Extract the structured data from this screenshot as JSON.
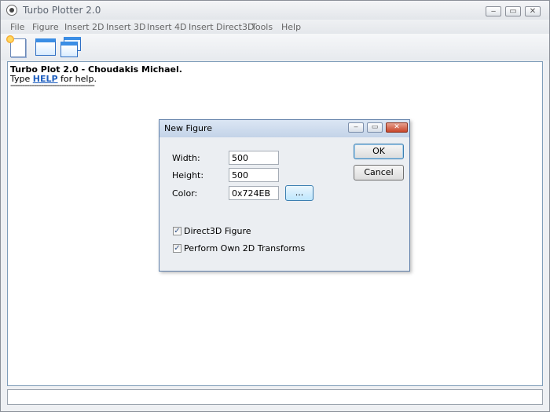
{
  "window": {
    "title": "Turbo Plotter 2.0",
    "controls": {
      "minimize": "‒",
      "maximize": "▭",
      "close": "✕"
    }
  },
  "menu": [
    "File",
    "Figure",
    "Insert 2D",
    "Insert 3D",
    "Insert 4D",
    "Insert Direct3D",
    "Tools",
    "Help"
  ],
  "toolbar": [
    "new-figure-icon",
    "window-icon",
    "cascade-windows-icon"
  ],
  "console": {
    "line1": "Turbo Plot 2.0 - Choudakis Michael.",
    "line2_prefix": "Type ",
    "line2_link": "HELP",
    "line2_suffix": " for help.",
    "line3": "------------------------------------"
  },
  "dialog": {
    "title": "New Figure",
    "width_label": "Width:",
    "width_value": "500",
    "height_label": "Height:",
    "height_value": "500",
    "color_label": "Color:",
    "color_value": "0x724EB",
    "color_picker_label": "...",
    "ok_label": "OK",
    "cancel_label": "Cancel",
    "checkbox1_label": "Direct3D Figure",
    "checkbox1_checked": true,
    "checkbox2_label": "Perform Own 2D Transforms",
    "checkbox2_checked": true,
    "check_glyph": "✓",
    "controls": {
      "minimize": "‒",
      "maximize": "▭",
      "close": "✕"
    }
  },
  "colors": {
    "accent": "#3c7fb1",
    "link": "#1f5fbf",
    "close_button": "#c8452a"
  }
}
